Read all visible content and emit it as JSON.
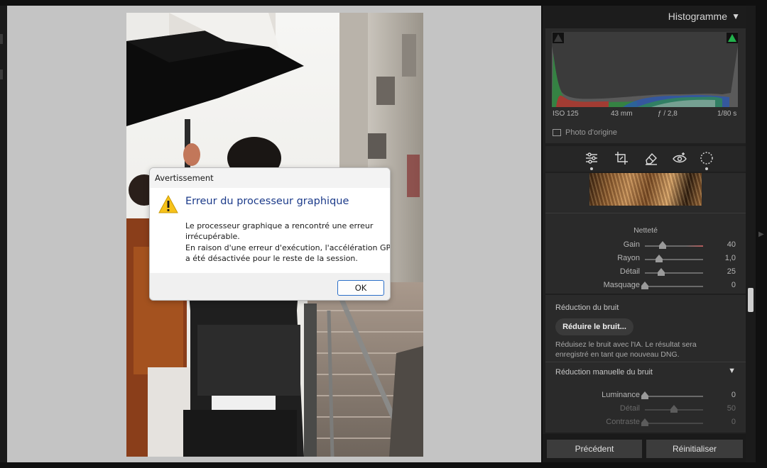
{
  "histogram": {
    "title": "Histogramme",
    "exif": {
      "iso": "ISO 125",
      "focal": "43 mm",
      "aperture": "ƒ / 2,8",
      "shutter": "1/80 s"
    },
    "original_photo_label": "Photo d'origine"
  },
  "tools": [
    "edit-sliders-icon",
    "crop-icon",
    "heal-eraser-icon",
    "red-eye-icon",
    "mask-icon"
  ],
  "detail": {
    "sharpening_title": "Netteté",
    "sliders": [
      {
        "label": "Gain",
        "value": "40",
        "level": 0.3
      },
      {
        "label": "Rayon",
        "value": "1,0",
        "level": 0.24
      },
      {
        "label": "Détail",
        "value": "25",
        "level": 0.28
      },
      {
        "label": "Masquage",
        "value": "0",
        "level": 0.0
      }
    ]
  },
  "noise": {
    "title": "Réduction du bruit",
    "button_label": "Réduire le bruit...",
    "description_line1": "Réduisez le bruit avec l'IA. Le résultat sera",
    "description_line2": "enregistré en tant que nouveau DNG."
  },
  "manual_noise": {
    "title": "Réduction manuelle du bruit",
    "arrow": "▼",
    "sliders": [
      {
        "label": "Luminance",
        "value": "0",
        "level": 0.0
      },
      {
        "label": "Détail",
        "value": "50",
        "level": 0.5
      },
      {
        "label": "Contraste",
        "value": "0",
        "level": 0.0
      }
    ]
  },
  "buttons": {
    "previous": "Précédent",
    "reset": "Réinitialiser"
  },
  "dialog": {
    "title": "Avertissement",
    "heading": "Erreur du processeur graphique",
    "line1": "Le processeur graphique a rencontré une erreur",
    "line2": "irrécupérable.",
    "line3": "En raison d'une erreur d'exécution, l'accélération GPU",
    "line4": "a été désactivée pour le reste de la session.",
    "ok_label": "OK"
  },
  "colors": {
    "dialog_heading": "#1c3b8a",
    "ok_border": "#2b6fc9",
    "clip_highlight": "#22b14c"
  }
}
